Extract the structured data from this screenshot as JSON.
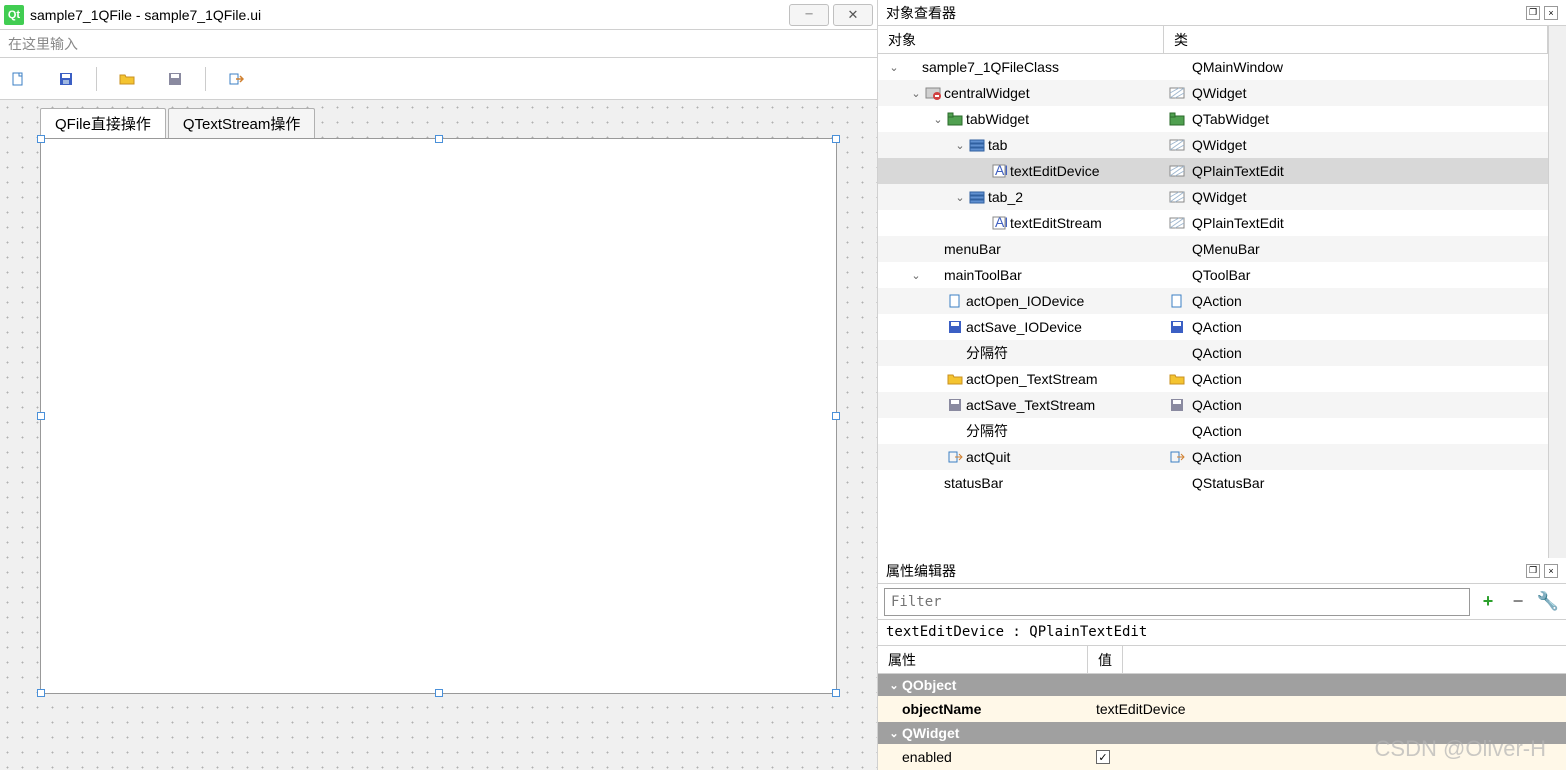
{
  "window": {
    "title": "sample7_1QFile - sample7_1QFile.ui",
    "menubar_hint": "在这里输入"
  },
  "designer": {
    "tabs": [
      "QFile直接操作",
      "QTextStream操作"
    ]
  },
  "object_inspector": {
    "title": "对象查看器",
    "columns": {
      "object": "对象",
      "class": "类"
    },
    "tree": [
      {
        "indent": 0,
        "expand": "v",
        "name": "sample7_1QFileClass",
        "class": "QMainWindow",
        "icon": ""
      },
      {
        "indent": 1,
        "expand": "v",
        "name": "centralWidget",
        "class": "QWidget",
        "icon": "widget-red"
      },
      {
        "indent": 2,
        "expand": "v",
        "name": "tabWidget",
        "class": "QTabWidget",
        "icon": "tabwidget"
      },
      {
        "indent": 3,
        "expand": "v",
        "name": "tab",
        "class": "QWidget",
        "icon": "layout"
      },
      {
        "indent": 4,
        "expand": "",
        "name": "textEditDevice",
        "class": "QPlainTextEdit",
        "icon": "textedit",
        "selected": true
      },
      {
        "indent": 3,
        "expand": "v",
        "name": "tab_2",
        "class": "QWidget",
        "icon": "layout"
      },
      {
        "indent": 4,
        "expand": "",
        "name": "textEditStream",
        "class": "QPlainTextEdit",
        "icon": "textedit"
      },
      {
        "indent": 1,
        "expand": "",
        "name": "menuBar",
        "class": "QMenuBar",
        "icon": ""
      },
      {
        "indent": 1,
        "expand": "v",
        "name": "mainToolBar",
        "class": "QToolBar",
        "icon": ""
      },
      {
        "indent": 2,
        "expand": "",
        "name": "actOpen_IODevice",
        "class": "QAction",
        "icon": "file-new"
      },
      {
        "indent": 2,
        "expand": "",
        "name": "actSave_IODevice",
        "class": "QAction",
        "icon": "save"
      },
      {
        "indent": 2,
        "expand": "",
        "name": "分隔符",
        "class": "QAction",
        "icon": ""
      },
      {
        "indent": 2,
        "expand": "",
        "name": "actOpen_TextStream",
        "class": "QAction",
        "icon": "folder"
      },
      {
        "indent": 2,
        "expand": "",
        "name": "actSave_TextStream",
        "class": "QAction",
        "icon": "save-as"
      },
      {
        "indent": 2,
        "expand": "",
        "name": "分隔符",
        "class": "QAction",
        "icon": ""
      },
      {
        "indent": 2,
        "expand": "",
        "name": "actQuit",
        "class": "QAction",
        "icon": "quit"
      },
      {
        "indent": 1,
        "expand": "",
        "name": "statusBar",
        "class": "QStatusBar",
        "icon": ""
      }
    ]
  },
  "property_editor": {
    "title": "属性编辑器",
    "filter_placeholder": "Filter",
    "selection": "textEditDevice : QPlainTextEdit",
    "columns": {
      "prop": "属性",
      "value": "值"
    },
    "groups": [
      {
        "name": "QObject",
        "props": [
          {
            "name": "objectName",
            "bold": true,
            "value": "textEditDevice",
            "type": "text"
          }
        ]
      },
      {
        "name": "QWidget",
        "props": [
          {
            "name": "enabled",
            "value": true,
            "type": "checkbox"
          }
        ]
      }
    ]
  },
  "watermark": "CSDN @Oliver-H"
}
